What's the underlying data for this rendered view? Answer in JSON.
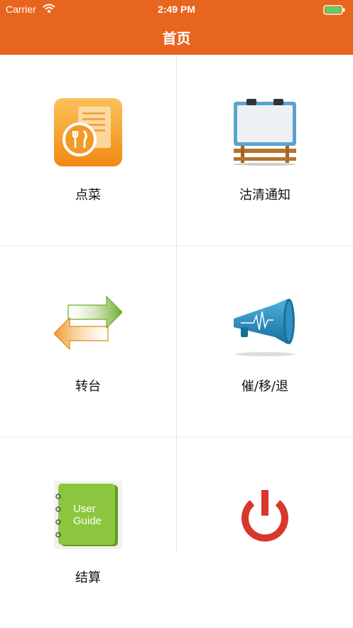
{
  "status_bar": {
    "carrier": "Carrier",
    "time": "2:49 PM",
    "icons": [
      "wifi-icon",
      "battery-icon"
    ]
  },
  "header": {
    "title": "首页",
    "background_color": "#e8651f"
  },
  "menu": {
    "items": [
      {
        "label": "点菜",
        "icon": "menu-order-icon"
      },
      {
        "label": "沽清通知",
        "icon": "billboard-icon"
      },
      {
        "label": "转台",
        "icon": "transfer-arrows-icon"
      },
      {
        "label": "催/移/退",
        "icon": "megaphone-icon"
      },
      {
        "label": "结算",
        "icon": "user-guide-icon",
        "icon_text": [
          "User",
          "Guide"
        ]
      },
      {
        "label": "",
        "icon": "power-icon"
      }
    ]
  },
  "colors": {
    "accent": "#e8651f",
    "power": "#d9372a",
    "guide_green": "#8cc63f"
  }
}
